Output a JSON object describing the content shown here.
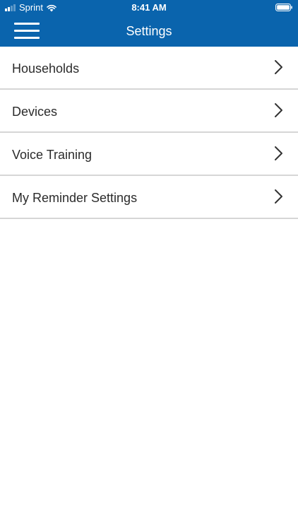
{
  "status_bar": {
    "carrier": "Sprint",
    "time": "8:41 AM",
    "icons": [
      "signal-icon",
      "wifi-icon",
      "battery-icon"
    ]
  },
  "nav": {
    "title": "Settings",
    "menu_icon": "hamburger-menu-icon"
  },
  "colors": {
    "header_bg": "#0a64ad",
    "header_text": "#ffffff",
    "divider": "#d6d6d6",
    "item_text": "#2b2b2b"
  },
  "settings": {
    "items": [
      {
        "label": "Households",
        "icon": "chevron-right-icon"
      },
      {
        "label": "Devices",
        "icon": "chevron-right-icon"
      },
      {
        "label": "Voice Training",
        "icon": "chevron-right-icon"
      },
      {
        "label": "My Reminder Settings",
        "icon": "chevron-right-icon"
      }
    ]
  }
}
